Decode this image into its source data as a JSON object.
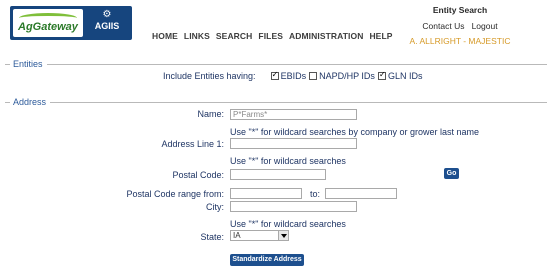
{
  "header": {
    "logo_agGateway": "AgGateway",
    "logo_agiis": "AGIIS",
    "nav": [
      "HOME",
      "LINKS",
      "SEARCH",
      "FILES",
      "ADMINISTRATION",
      "HELP"
    ],
    "page_title": "Entity Search",
    "contact_us": "Contact Us",
    "logout": "Logout",
    "user": "A. ALLRIGHT - MAJESTIC"
  },
  "entities": {
    "legend": "Entities",
    "include_label": "Include Entities having:",
    "options": [
      {
        "label": "EBIDs",
        "checked": true
      },
      {
        "label": "NAPD/HP IDs",
        "checked": false
      },
      {
        "label": "GLN IDs",
        "checked": true
      }
    ]
  },
  "address": {
    "legend": "Address",
    "name_label": "Name:",
    "name_value": "P*Farms*",
    "name_hint": "Use \"*\" for wildcard searches by company or grower last name",
    "address1_label": "Address Line 1:",
    "address1_value": "",
    "address1_hint": "Use \"*\" for wildcard searches",
    "postal_label": "Postal Code:",
    "postal_value": "",
    "go_label": "Go",
    "postal_range_label": "Postal Code range from:",
    "postal_from": "",
    "to_label": "to:",
    "postal_to": "",
    "city_label": "City:",
    "city_value": "",
    "city_hint": "Use \"*\" for wildcard searches",
    "state_label": "State:",
    "state_value": "IA",
    "standardize_label": "Standardize Address"
  }
}
